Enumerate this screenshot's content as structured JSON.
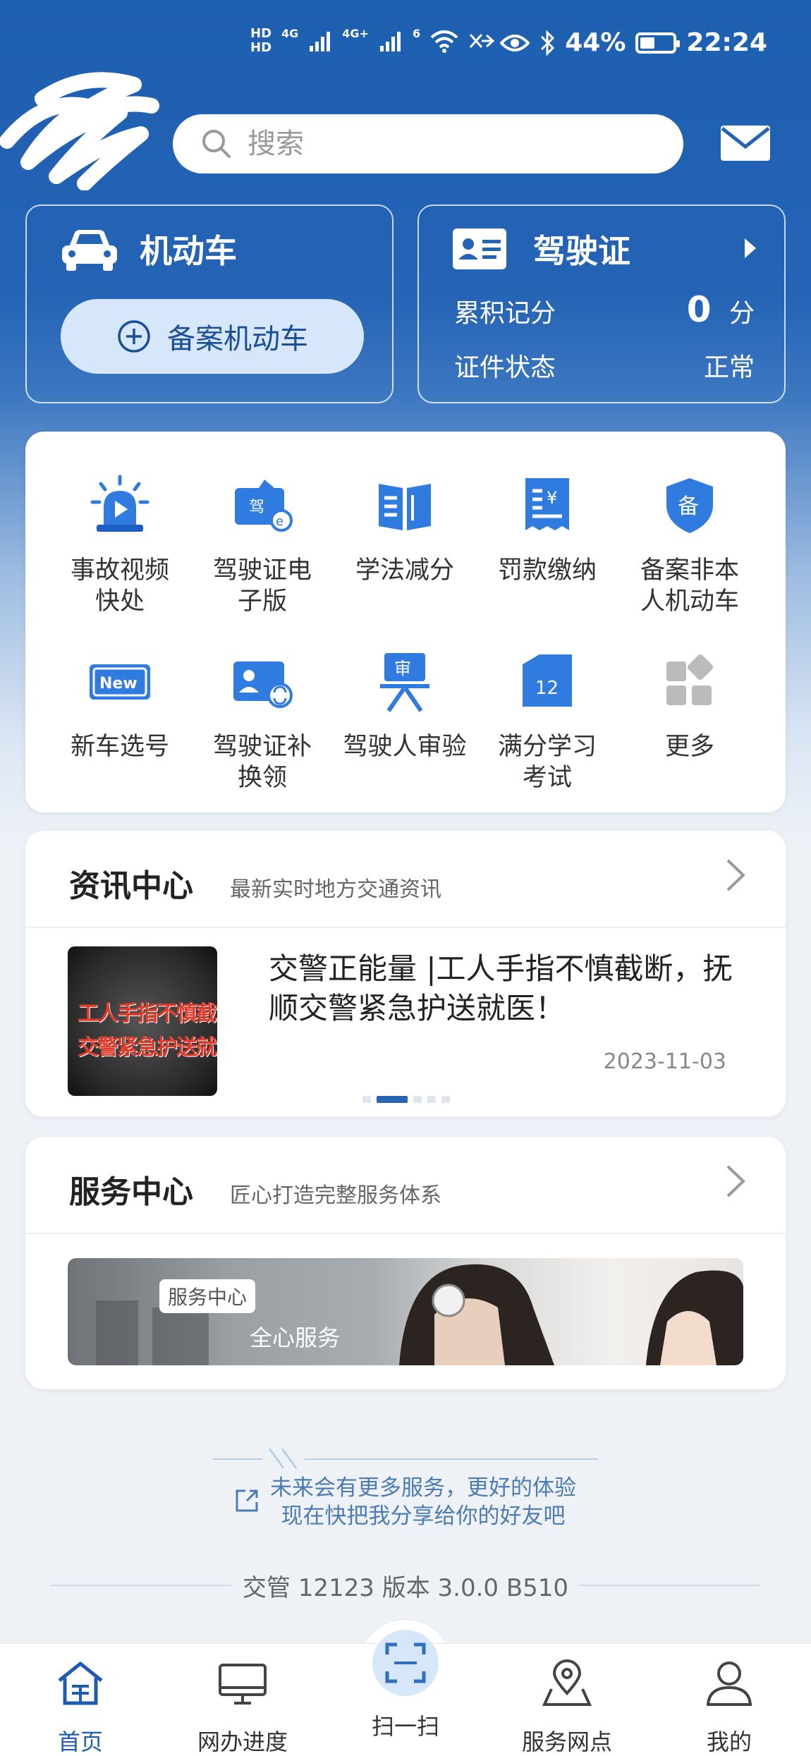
{
  "status_bar": {
    "hd1": "HD",
    "hd2": "HD",
    "net1": "4G",
    "net2": "4G+",
    "wifi_sup": "6",
    "battery": "44%",
    "time": "22:24"
  },
  "header": {
    "search_placeholder": "搜索"
  },
  "vehicle_card": {
    "title": "机动车",
    "register_button": "备案机动车"
  },
  "license_card": {
    "title": "驾驶证",
    "points_label": "累积记分",
    "points_value": "0",
    "points_unit": "分",
    "status_label": "证件状态",
    "status_value": "正常"
  },
  "quick_menu": {
    "items": [
      {
        "label": "事故视频快处",
        "icon": "alarm-light-icon"
      },
      {
        "label": "驾驶证电子版",
        "icon": "e-license-icon"
      },
      {
        "label": "学法减分",
        "icon": "book-icon"
      },
      {
        "label": "罚款缴纳",
        "icon": "receipt-yen-icon"
      },
      {
        "label": "备案非本人机动车",
        "icon": "shield-icon"
      },
      {
        "label": "新车选号",
        "icon": "new-plate-icon"
      },
      {
        "label": "驾驶证补换领",
        "icon": "id-exchange-icon"
      },
      {
        "label": "驾驶人审验",
        "icon": "review-stand-icon"
      },
      {
        "label": "满分学习考试",
        "icon": "calendar-12-icon"
      },
      {
        "label": "更多",
        "icon": "more-grid-icon"
      }
    ]
  },
  "news": {
    "title": "资讯中心",
    "subtitle": "最新实时地方交通资讯",
    "thumb_line1": "工人手指不慎截断",
    "thumb_line2": "交警紧急护送就医",
    "headline": "交警正能量 |工人手指不慎截断，抚顺交警紧急护送就医！",
    "date": "2023-11-03"
  },
  "service": {
    "title": "服务中心",
    "subtitle": "匠心打造完整服务体系",
    "badge": "服务中心",
    "banner_text": "全心服务"
  },
  "share": {
    "line1": "未来会有更多服务，更好的体验",
    "line2": "现在快把我分享给你的好友吧"
  },
  "version": "交管 12123 版本 3.0.0 B510",
  "tabs": [
    {
      "label": "首页",
      "icon": "home-icon"
    },
    {
      "label": "网办进度",
      "icon": "monitor-icon"
    },
    {
      "label": "扫一扫",
      "icon": "scan-icon"
    },
    {
      "label": "服务网点",
      "icon": "map-pin-icon"
    },
    {
      "label": "我的",
      "icon": "user-icon"
    }
  ],
  "colors": {
    "brand_blue": "#1e5cb0",
    "header_gradient_top": "#1d5fb0",
    "icon_blue": "#2f7be0",
    "pill_bg": "#d6e6fb"
  }
}
